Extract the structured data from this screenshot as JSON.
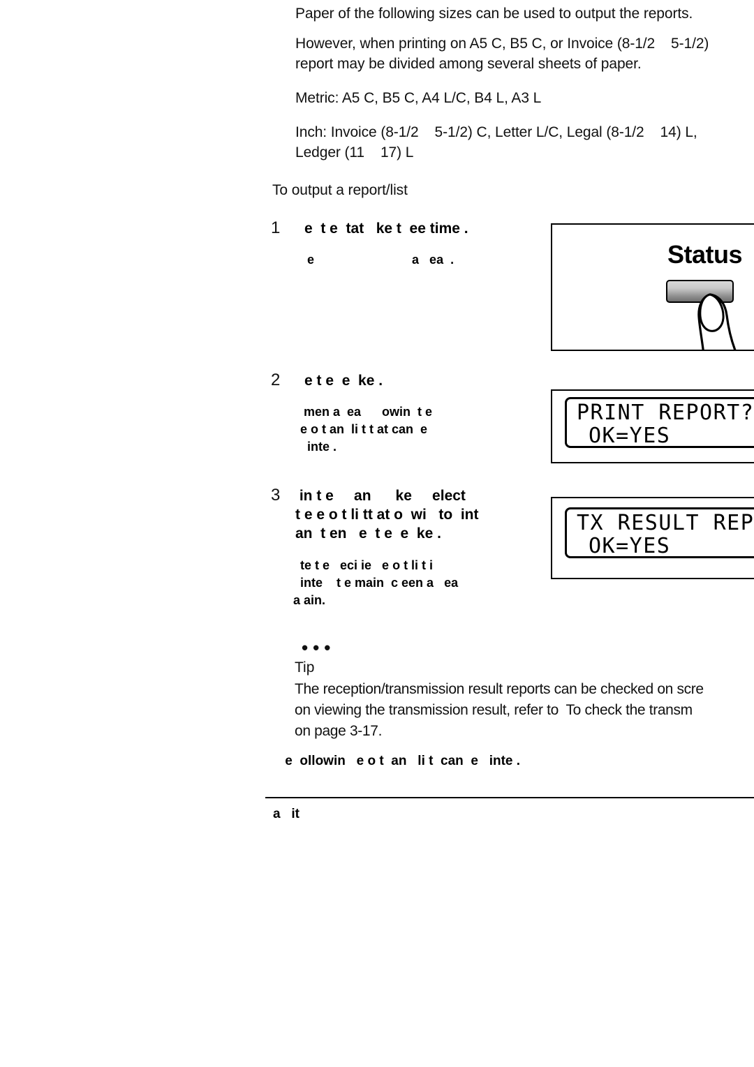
{
  "page": {
    "intro_paragraphs": [
      "Paper of the following sizes can be used to output the reports.",
      "However, when printing on A5 C, B5 C, or Invoice (8-1/2    5-1/2)\nreport may be divided among several sheets of paper.",
      "Metric: A5 C, B5 C, A4 L/C, B4 L, A3 L",
      "Inch: Invoice (8-1/2    5-1/2) C, Letter L/C, Legal (8-1/2    14) L,\nLedger (11    17) L"
    ],
    "procedure_title": "To output a report/list"
  },
  "steps": [
    {
      "number": "1",
      "title": "e  t e  tat   ke t  ee time .",
      "sub": "e                            a   ea  ."
    },
    {
      "number": "2",
      "title": "e t e  e  ke .",
      "sub": " men a  ea      owin  t e\ne o t an  li t t at can  e\n  inte ."
    },
    {
      "number": "3",
      "title": " in t e     an      ke     elect\nt e e o t li tt at o  wi   to  int\nan  t en   e  t e  e  ke .",
      "sub": "  te t e   eci ie   e o t li t i\n  inte    t e main  c een a   ea\na ain."
    }
  ],
  "illustrations": {
    "status_key": {
      "label": "Status"
    },
    "lcd_1": {
      "line1": "PRINT REPORT?",
      "line2": "OK=YES"
    },
    "lcd_2": {
      "line1": "TX RESULT REPO",
      "line2": "OK=YES"
    }
  },
  "tip": {
    "dots": "•••",
    "label": "Tip",
    "body": "The reception/transmission result reports can be checked on scre\non viewing the transmission result, refer to  To check the transm\non page 3-17."
  },
  "bottom": {
    "heading": " e  ollowin   e o t  an   li t  can  e   inte .",
    "table_header": "a   it"
  }
}
